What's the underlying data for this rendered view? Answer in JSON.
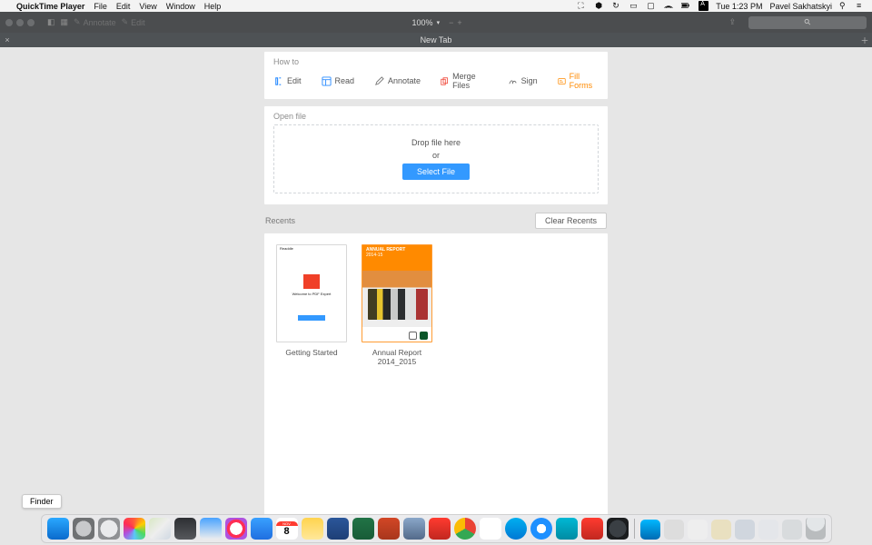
{
  "menubar": {
    "app": "QuickTime Player",
    "items": [
      "File",
      "Edit",
      "View",
      "Window",
      "Help"
    ],
    "time": "Tue 1:23 PM",
    "user": "Pavel Sakhatskyi"
  },
  "toolbar": {
    "annotate": "Annotate",
    "edit": "Edit",
    "zoom": "100%",
    "search_icon_glyph": "⚲"
  },
  "tab": {
    "title": "New Tab"
  },
  "howto": {
    "title": "How to",
    "items": [
      {
        "label": "Edit",
        "icon": "text-cursor-icon"
      },
      {
        "label": "Read",
        "icon": "layout-icon"
      },
      {
        "label": "Annotate",
        "icon": "pencil-icon"
      },
      {
        "label": "Merge Files",
        "icon": "merge-icon"
      },
      {
        "label": "Sign",
        "icon": "sign-icon"
      },
      {
        "label": "Fill Forms",
        "icon": "form-icon",
        "active": true
      }
    ]
  },
  "openfile": {
    "title": "Open file",
    "drop_label": "Drop file here",
    "or_label": "or",
    "select_label": "Select File"
  },
  "recents": {
    "title": "Recents",
    "clear_label": "Clear Recents",
    "docs": [
      {
        "label": "Getting Started",
        "thumb_caption_top": "Readdle",
        "thumb_caption_mid": "Welcome to PDF Expert"
      },
      {
        "label": "Annual Report 2014_2015",
        "thumb_caption_top": "ANNUAL REPORT",
        "thumb_caption_sub": "2014-15"
      }
    ]
  },
  "dock": {
    "tooltip": "Finder",
    "apps": [
      {
        "name": "finder",
        "bg": "linear-gradient(#2aa8ff,#0a6acc)"
      },
      {
        "name": "system-preferences",
        "bg": "radial-gradient(circle,#c8c9cb 0 50%,#6f7173 51% 100%)"
      },
      {
        "name": "launchpad",
        "bg": "radial-gradient(circle,#e9eaec 0 55%,#8f9194 56% 100%)"
      },
      {
        "name": "photos",
        "bg": "conic-gradient(#ff5e3a,#ffcc00,#4cd964,#5ac8fa,#af52de,#ff2d55,#ff5e3a)"
      },
      {
        "name": "maps",
        "bg": "linear-gradient(135deg,#d8e8c4,#eee,#cfd8e2)"
      },
      {
        "name": "mission-control",
        "bg": "linear-gradient(#2d2f33,#56585c)"
      },
      {
        "name": "preview",
        "bg": "linear-gradient(#4aa3ff,#eee)"
      },
      {
        "name": "itunes",
        "bg": "radial-gradient(circle,#fff 0 40%,#ff2d55 41% 60%,#af52de 61% 100%)"
      },
      {
        "name": "app-store",
        "bg": "linear-gradient(#39a0ff,#1f6fe0)"
      },
      {
        "name": "calendar",
        "bg": "#fff"
      },
      {
        "name": "notes",
        "bg": "linear-gradient(#ffd34e,#ffe89a)"
      },
      {
        "name": "word",
        "bg": "linear-gradient(#2b579a,#1e3f76)"
      },
      {
        "name": "excel",
        "bg": "linear-gradient(#217346,#185c37)"
      },
      {
        "name": "powerpoint",
        "bg": "linear-gradient(#d24726,#a8361c)"
      },
      {
        "name": "generic1",
        "bg": "linear-gradient(#8aa7c9,#536a8a)"
      },
      {
        "name": "pdf-expert",
        "bg": "linear-gradient(#ff3b30,#c1271f)"
      },
      {
        "name": "chrome",
        "bg": "conic-gradient(#ea4335 0 120deg,#34a853 120deg 240deg,#fbbc05 240deg 360deg)"
      },
      {
        "name": "slack",
        "bg": "#fff"
      },
      {
        "name": "skype",
        "bg": "linear-gradient(#00aff0,#0078d4)"
      },
      {
        "name": "safari",
        "bg": "radial-gradient(circle,#fff 0 30%,#1e90ff 31% 100%)"
      },
      {
        "name": "app-teal",
        "bg": "linear-gradient(#00b8d4,#008ba3)"
      },
      {
        "name": "pdf-expert-alt",
        "bg": "linear-gradient(#ff3b30,#c1271f)"
      },
      {
        "name": "quicktime",
        "bg": "radial-gradient(circle,#3a3f44 0 55%,#1b1d1f 56% 100%)"
      }
    ],
    "right_apps": [
      {
        "name": "spark",
        "bg": "linear-gradient(#00b8ff,#006bb3)"
      },
      {
        "name": "r1",
        "bg": "#ddd"
      },
      {
        "name": "r2",
        "bg": "#eee"
      },
      {
        "name": "r3",
        "bg": "#e9e0c0"
      },
      {
        "name": "r4",
        "bg": "#d0d6de"
      },
      {
        "name": "r5",
        "bg": "#e4e6ea"
      },
      {
        "name": "r6",
        "bg": "#d8dbdd"
      }
    ],
    "calendar": {
      "month": "NOV",
      "day": "8"
    }
  }
}
